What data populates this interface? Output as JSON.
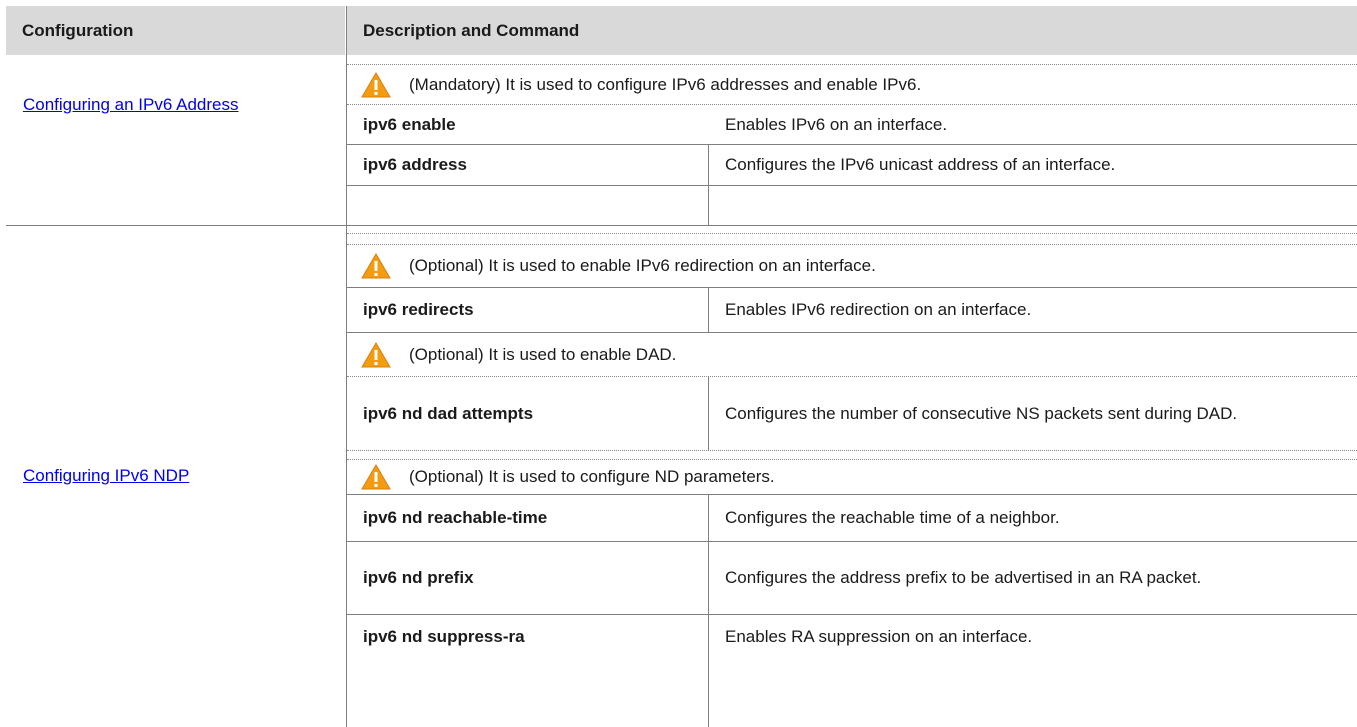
{
  "table": {
    "headers": {
      "configuration": "Configuration",
      "description": "Description and Command"
    },
    "sections": [
      {
        "link": "Configuring an IPv6 Address",
        "groups": [
          {
            "note": "(Mandatory) It is used to configure IPv6 addresses and enable IPv6.",
            "rows": [
              {
                "cmd": "ipv6 enable",
                "desc": "Enables IPv6 on an interface."
              },
              {
                "cmd": "ipv6 address",
                "desc": "Configures the IPv6 unicast address of an interface."
              }
            ]
          }
        ]
      },
      {
        "link": "Configuring IPv6 NDP",
        "groups": [
          {
            "note": "(Optional) It is used to enable IPv6 redirection on an interface.",
            "rows": [
              {
                "cmd": "ipv6 redirects",
                "desc": "Enables IPv6 redirection on an interface."
              }
            ]
          },
          {
            "note": "(Optional) It is used to enable DAD.",
            "rows": [
              {
                "cmd": "ipv6 nd dad attempts",
                "desc": "Configures the number of consecutive NS packets sent during DAD."
              }
            ]
          },
          {
            "note": "(Optional) It is used to configure ND parameters.",
            "rows": [
              {
                "cmd": "ipv6 nd reachable-time",
                "desc": "Configures the reachable time of a neighbor."
              },
              {
                "cmd": "ipv6 nd prefix",
                "desc": "Configures the address prefix to be advertised in an RA packet."
              },
              {
                "cmd": "ipv6 nd suppress-ra",
                "desc": "Enables RA suppression on an interface."
              }
            ]
          }
        ]
      }
    ]
  },
  "icons": {
    "warning": "warning-icon"
  },
  "colors": {
    "header_bg": "#d9d9d9",
    "link": "#0000ee",
    "warning_fill": "#f39c12"
  }
}
